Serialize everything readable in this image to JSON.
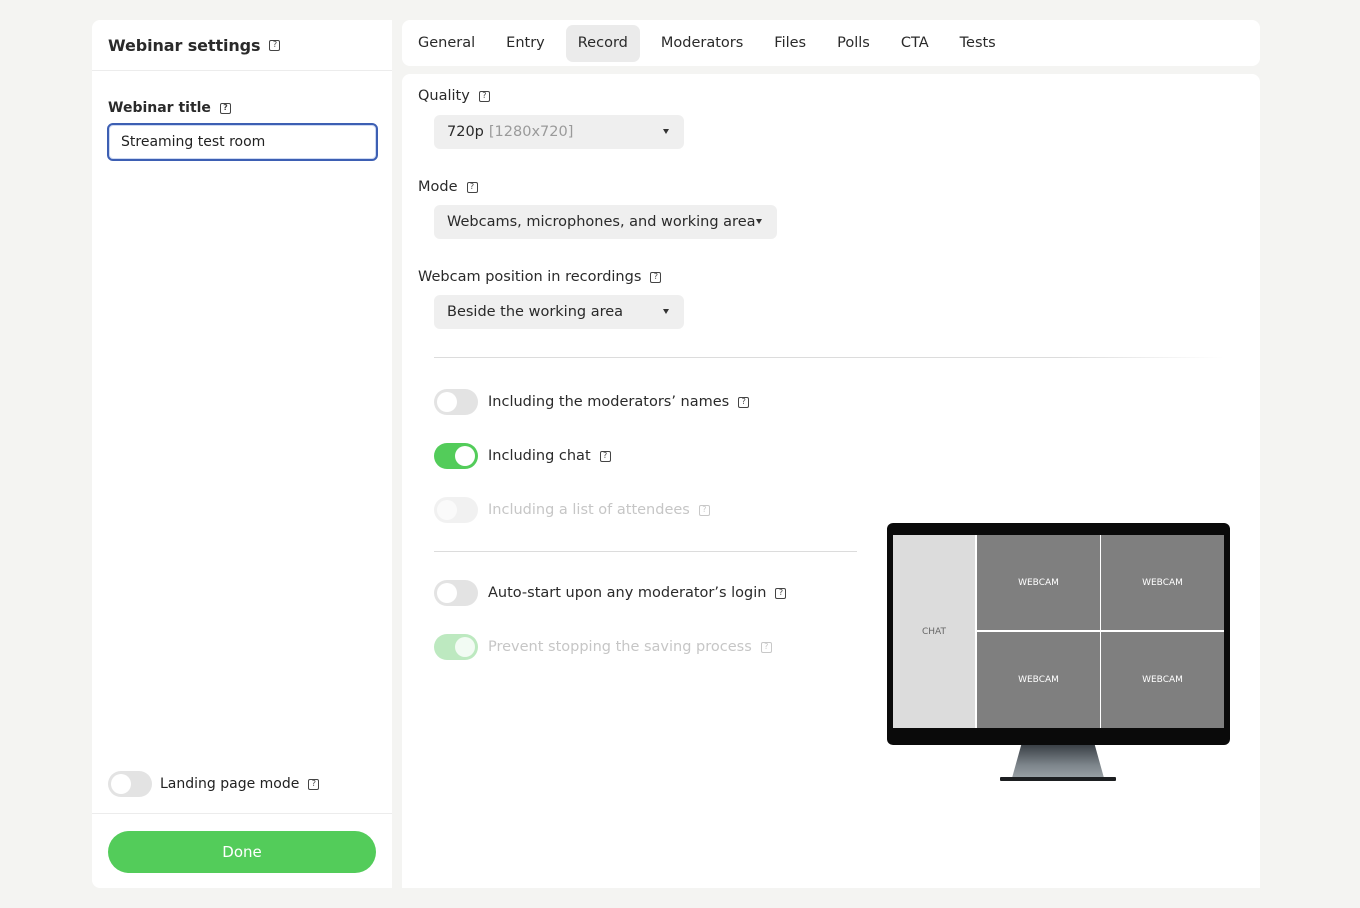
{
  "settings_panel": {
    "title": "Webinar settings",
    "webinar_title_label": "Webinar title",
    "webinar_title_value": "Streaming test room",
    "landing_page_mode_label": "Landing page mode",
    "landing_page_mode_on": false,
    "done_label": "Done"
  },
  "tabs": [
    {
      "label": "General",
      "active": false
    },
    {
      "label": "Entry",
      "active": false
    },
    {
      "label": "Record",
      "active": true
    },
    {
      "label": "Moderators",
      "active": false
    },
    {
      "label": "Files",
      "active": false
    },
    {
      "label": "Polls",
      "active": false
    },
    {
      "label": "CTA",
      "active": false
    },
    {
      "label": "Tests",
      "active": false
    }
  ],
  "record": {
    "quality_label": "Quality",
    "quality_value": "720p",
    "quality_resolution": "[1280x720]",
    "mode_label": "Mode",
    "mode_value": "Webcams, microphones, and working area",
    "webcam_position_label": "Webcam position in recordings",
    "webcam_position_value": "Beside the working area",
    "options": {
      "moderators_names": {
        "label": "Including the moderators’ names",
        "on": false,
        "disabled": false
      },
      "chat": {
        "label": "Including chat",
        "on": true,
        "disabled": false
      },
      "attendees_list": {
        "label": "Including a list of attendees",
        "on": false,
        "disabled": true
      },
      "auto_start": {
        "label": "Auto-start upon any moderator’s login",
        "on": false,
        "disabled": false
      },
      "prevent_stopping": {
        "label": "Prevent stopping the saving process",
        "on": true,
        "disabled": true
      }
    },
    "preview": {
      "chat_label": "CHAT",
      "webcam_labels": [
        "WEBCAM",
        "WEBCAM",
        "WEBCAM",
        "WEBCAM"
      ]
    }
  },
  "colors": {
    "accent_green": "#53cc5a",
    "focus_blue": "#3d5fb3"
  },
  "icons": {
    "help": "help-square-icon",
    "dropdown": "caret-down-icon"
  }
}
